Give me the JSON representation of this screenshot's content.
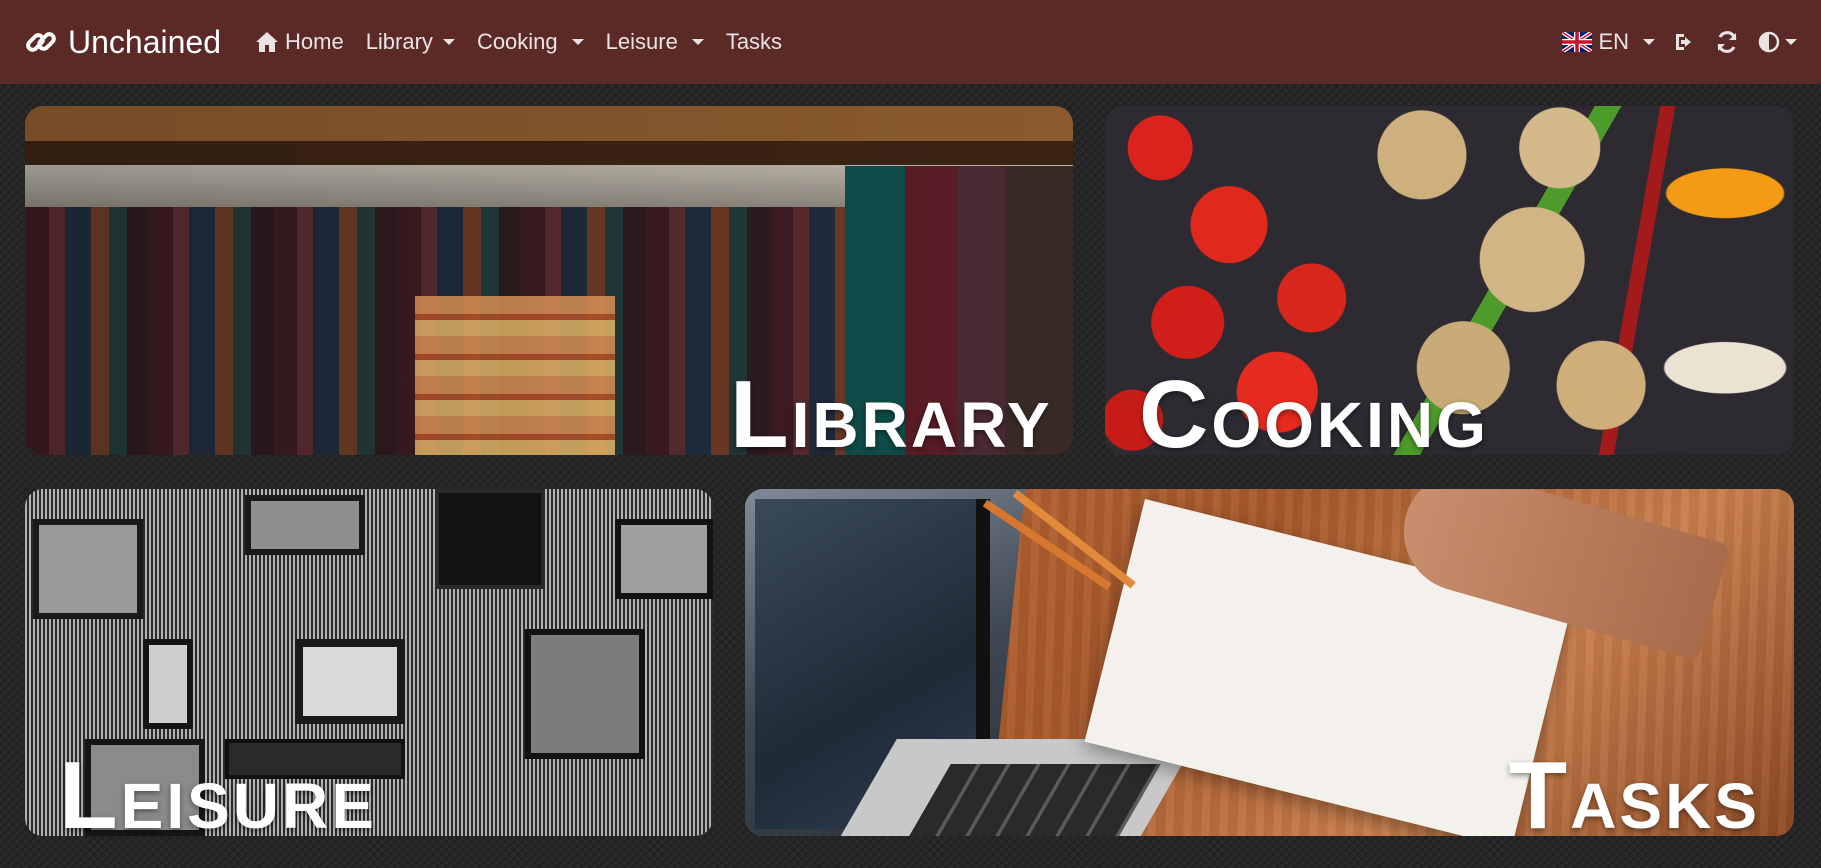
{
  "navbar": {
    "brand": "Unchained",
    "items": [
      {
        "label": "Home",
        "icon": "home-icon",
        "dropdown": false
      },
      {
        "label": "Library",
        "dropdown": true
      },
      {
        "label": "Cooking",
        "dropdown": true
      },
      {
        "label": "Leisure",
        "dropdown": true
      },
      {
        "label": "Tasks",
        "dropdown": false
      }
    ],
    "language": "EN",
    "right_icons": [
      "logout-icon",
      "refresh-icon",
      "theme-contrast-icon"
    ]
  },
  "tiles": {
    "library": {
      "first": "L",
      "rest": "ibrary",
      "image": "bookshelf"
    },
    "cooking": {
      "first": "C",
      "rest": "ooking",
      "image": "vegetables"
    },
    "leisure": {
      "first": "L",
      "rest": "eisure",
      "image": "amplifiers-and-records"
    },
    "tasks": {
      "first": "T",
      "rest": "asks",
      "image": "notebook-and-laptop"
    }
  },
  "colors": {
    "navbar": "#5b2a27",
    "background": "#262626",
    "text": "#ffffff"
  }
}
